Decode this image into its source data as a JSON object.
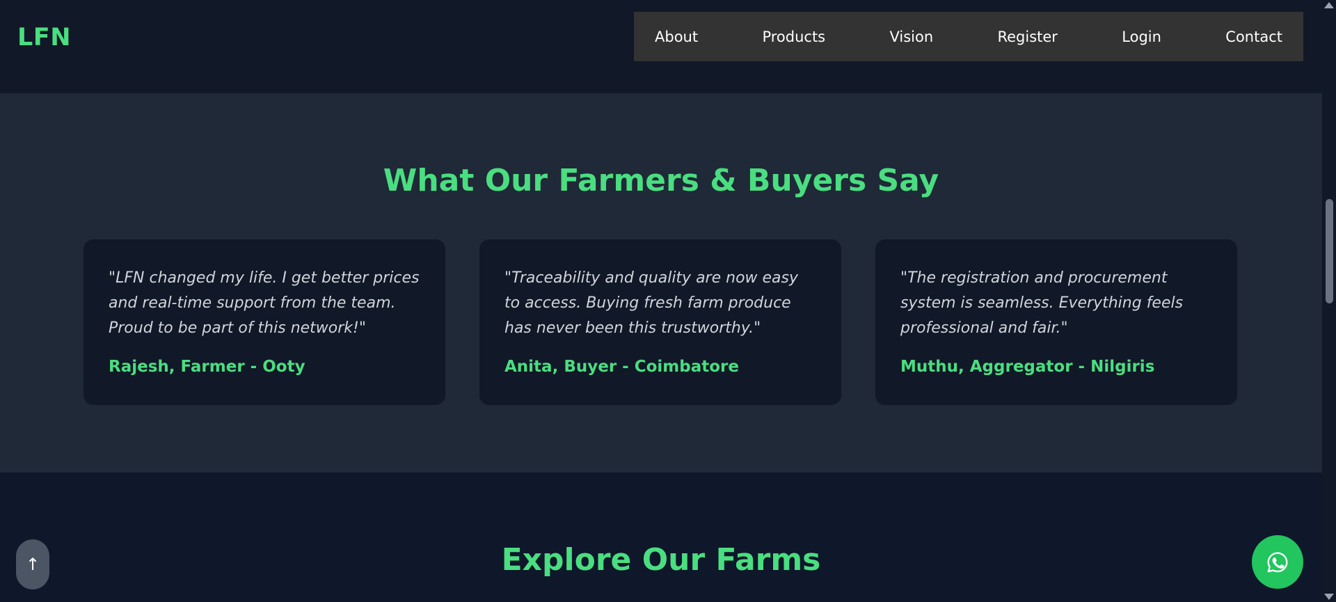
{
  "header": {
    "logo": "LFN",
    "nav": [
      "About",
      "Products",
      "Vision",
      "Register",
      "Login",
      "Contact"
    ]
  },
  "testimonials": {
    "title": "What Our Farmers & Buyers Say",
    "items": [
      {
        "quote": "\"LFN changed my life. I get better prices and real-time support from the team. Proud to be part of this network!\"",
        "author": "Rajesh, Farmer - Ooty"
      },
      {
        "quote": "\"Traceability and quality are now easy to access. Buying fresh farm produce has never been this trustworthy.\"",
        "author": "Anita, Buyer - Coimbatore"
      },
      {
        "quote": "\"The registration and procurement system is seamless. Everything feels professional and fair.\"",
        "author": "Muthu, Aggregator - Nilgiris"
      }
    ]
  },
  "farms": {
    "title": "Explore Our Farms"
  },
  "buttons": {
    "scroll_top_label": "↑",
    "whatsapp_icon": "whatsapp-icon"
  },
  "colors": {
    "accent": "#4ade80",
    "header_bg": "#111827",
    "nav_bg": "#333333",
    "section_bg": "#1f2937",
    "card_bg": "#111827",
    "page_bg": "#0f172a",
    "whatsapp": "#22c55e"
  }
}
